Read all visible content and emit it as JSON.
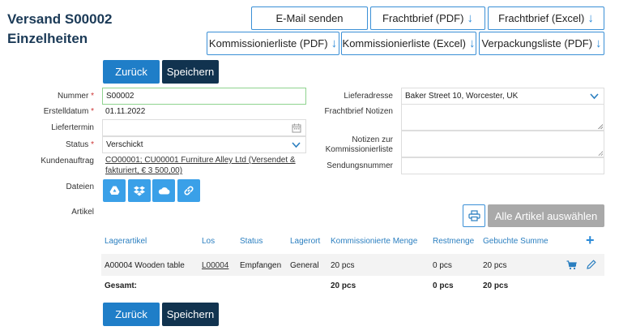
{
  "header": {
    "title_line1": "Versand S00002",
    "title_line2": "Einzelheiten"
  },
  "actions": {
    "email": "E-Mail senden",
    "frachtbrief_pdf": "Frachtbrief (PDF)",
    "frachtbrief_excel": "Frachtbrief (Excel)",
    "kommission_pdf": "Kommissionierliste (PDF)",
    "kommission_excel": "Kommissionierliste (Excel)",
    "verpackung_pdf": "Verpackungsliste (PDF)",
    "download_icon": "download-arrow"
  },
  "buttons": {
    "back": "Zurück",
    "save": "Speichern"
  },
  "form": {
    "nummer_label": "Nummer",
    "nummer_value": "S00002",
    "erstelldatum_label": "Erstelldatum",
    "erstelldatum_value": "01.11.2022",
    "liefertermin_label": "Liefertermin",
    "liefertermin_value": "",
    "status_label": "Status",
    "status_value": "Verschickt",
    "kundenauftrag_label": "Kundenauftrag",
    "kundenauftrag_value": "CO00001; CU00001 Furniture Alley Ltd (Versendet & fakturiert, € 3 500,00)",
    "dateien_label": "Dateien",
    "artikel_label": "Artikel",
    "lieferadresse_label": "Lieferadresse",
    "lieferadresse_value": "Baker Street 10, Worcester, UK",
    "frachtbrief_notizen_label": "Frachtbrief Notizen",
    "notizen_kommission_label": "Notizen zur Kommissionierliste",
    "sendungsnummer_label": "Sendungsnummer",
    "required_mark": "*"
  },
  "file_icons": [
    "google-drive-icon",
    "dropbox-icon",
    "onedrive-icon",
    "link-icon"
  ],
  "artikel": {
    "print_icon": "printer-icon",
    "select_all_button": "Alle Artikel auswählen",
    "columns": {
      "lagerartikel": "Lagerartikel",
      "los": "Los",
      "status": "Status",
      "lagerort": "Lagerort",
      "kommissioniert": "Kommissionierte Menge",
      "restmenge": "Restmenge",
      "gebucht": "Gebuchte Summe",
      "add": "+"
    },
    "rows": [
      {
        "lagerartikel": "A00004 Wooden table",
        "los": "L00004",
        "status": "Empfangen",
        "lagerort": "General",
        "kommissioniert": "20 pcs",
        "restmenge": "0 pcs",
        "gebucht": "20 pcs"
      }
    ],
    "totals": {
      "label": "Gesamt:",
      "kommissioniert": "20 pcs",
      "restmenge": "0 pcs",
      "gebucht": "20 pcs"
    }
  },
  "colors": {
    "accent": "#1f7ec8",
    "dark": "#11334f",
    "title": "#1b3a57",
    "disabled": "#a9a9a9"
  }
}
